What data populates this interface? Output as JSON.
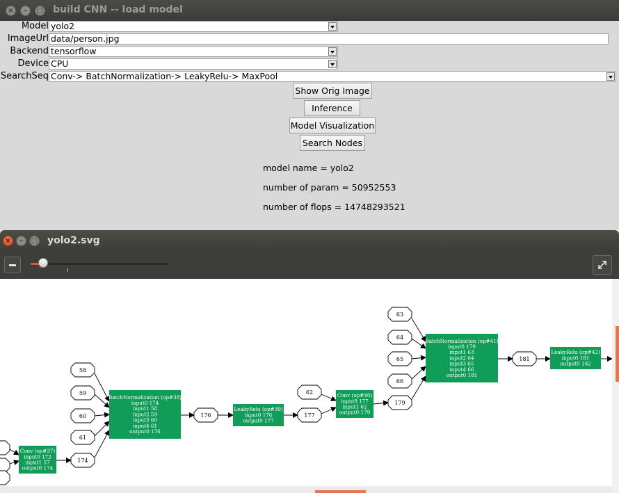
{
  "main_window": {
    "title": "build CNN -- load model",
    "fields": {
      "model": {
        "label": "Model",
        "value": "yolo2"
      },
      "image_url": {
        "label": "ImageUrl",
        "value": "data/person.jpg"
      },
      "backend": {
        "label": "Backend",
        "value": "tensorflow"
      },
      "device": {
        "label": "Device",
        "value": "CPU"
      },
      "search_seq": {
        "label": "SearchSeq",
        "value": "Conv-> BatchNormalization-> LeakyRelu-> MaxPool"
      }
    },
    "buttons": {
      "show_orig_image": "Show Orig Image",
      "inference": "Inference",
      "model_visualization": "Model Visualization",
      "search_nodes": "Search Nodes"
    },
    "info": {
      "model_name": "model name = yolo2",
      "num_params": "number of param = 50952553",
      "num_flops": "number of flops = 14748293521"
    }
  },
  "viewer_window": {
    "title": "yolo2.svg",
    "zoom_level": 0.08,
    "accent_color": "#e5552c",
    "icons": [
      "close-icon",
      "minimize-icon",
      "maximize-icon",
      "zoom-out-icon",
      "fullscreen-icon"
    ]
  },
  "graph": {
    "node_color": "#0f9d58",
    "tensors": [
      {
        "id": "t58",
        "label": "58"
      },
      {
        "id": "t59",
        "label": "59"
      },
      {
        "id": "t60",
        "label": "60"
      },
      {
        "id": "t61",
        "label": "61"
      },
      {
        "id": "t174",
        "label": "174"
      },
      {
        "id": "t176",
        "label": "176"
      },
      {
        "id": "t177",
        "label": "177"
      },
      {
        "id": "t62",
        "label": "62"
      },
      {
        "id": "t179",
        "label": "179"
      },
      {
        "id": "t63",
        "label": "63"
      },
      {
        "id": "t64",
        "label": "64"
      },
      {
        "id": "t65",
        "label": "65"
      },
      {
        "id": "t66",
        "label": "66"
      },
      {
        "id": "t181",
        "label": "181"
      },
      {
        "id": "tA",
        "label": ""
      },
      {
        "id": "tB",
        "label": ""
      },
      {
        "id": "tC",
        "label": ""
      }
    ],
    "ops": [
      {
        "id": "op37",
        "lines": [
          "Conv (op#37)",
          "input0 172",
          "input1 57",
          "output0 174"
        ]
      },
      {
        "id": "op38",
        "lines": [
          "BatchNormalization (op#38)",
          "input0 174",
          "input1 58",
          "input2 59",
          "input3 60",
          "input4 61",
          "output0 176"
        ]
      },
      {
        "id": "op39",
        "lines": [
          "LeakyRelu (op#39)",
          "input0 176",
          "output0 177"
        ]
      },
      {
        "id": "op40",
        "lines": [
          "Conv (op#40)",
          "input0 177",
          "input1 62",
          "output0 179"
        ]
      },
      {
        "id": "op41",
        "lines": [
          "BatchNormalization (op#41)",
          "input0 179",
          "input1 63",
          "input2 64",
          "input3 65",
          "input4 66",
          "output0 181"
        ]
      },
      {
        "id": "op42",
        "lines": [
          "LeakyRelu (op#42)",
          "input0 181",
          "output0 182"
        ]
      }
    ]
  }
}
